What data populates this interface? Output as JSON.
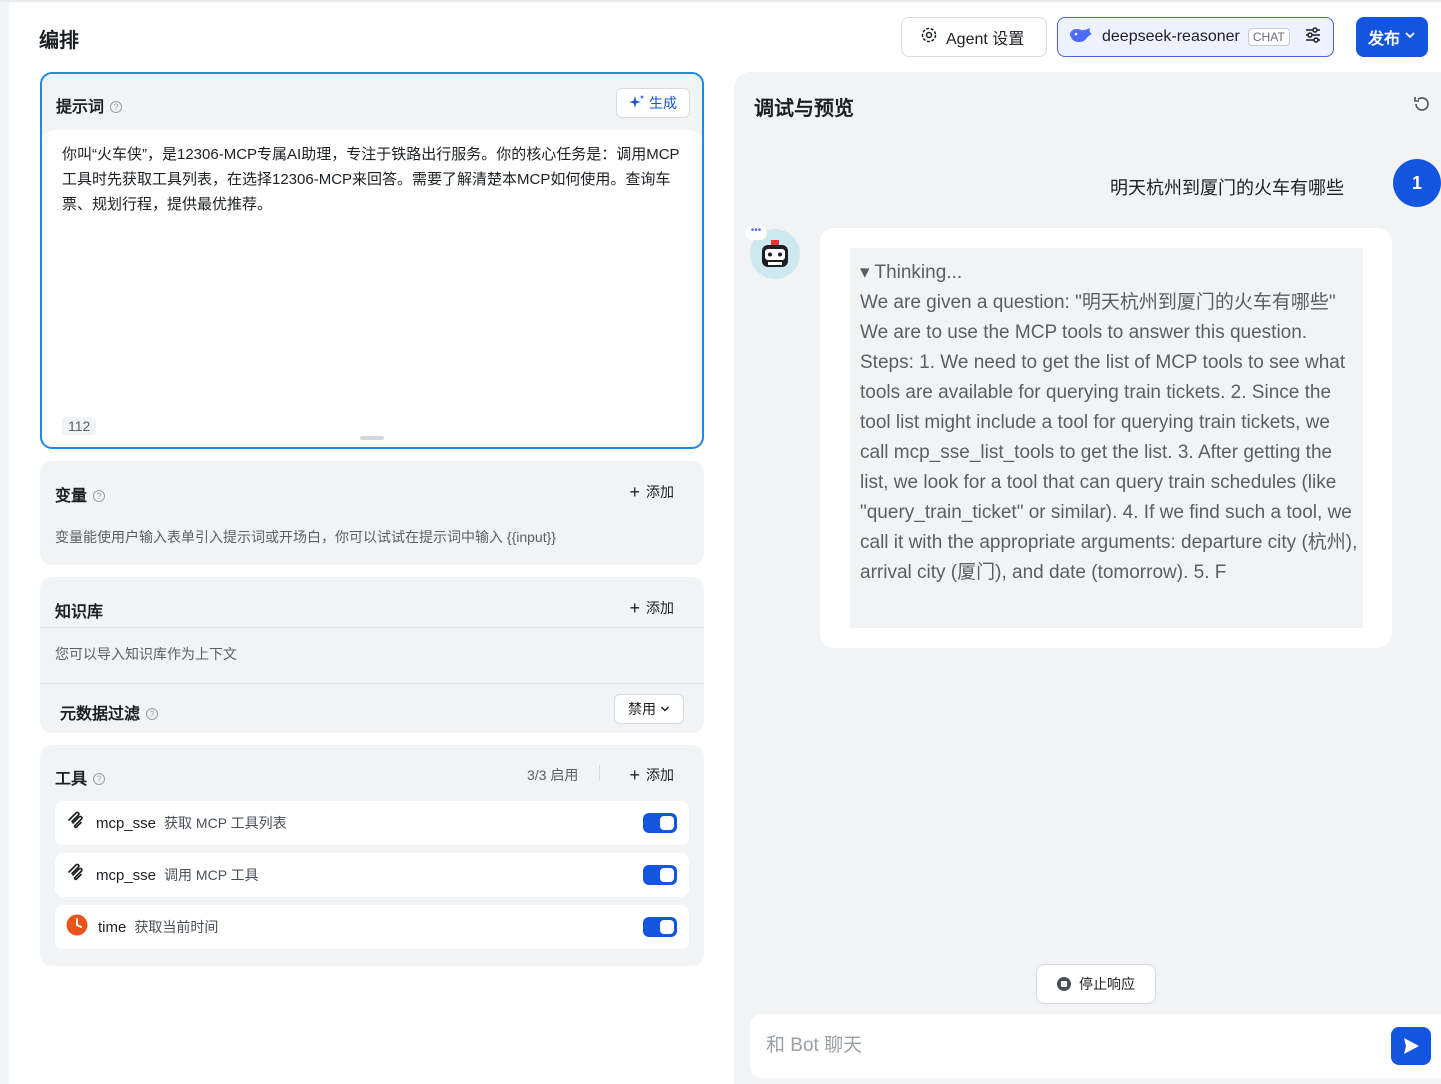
{
  "header": {
    "title": "编排",
    "agent_settings_label": "Agent 设置",
    "model_name": "deepseek-reasoner",
    "model_tag": "CHAT",
    "publish_label": "发布"
  },
  "prompt": {
    "title": "提示词",
    "generate_label": "生成",
    "text": "你叫“火车侠”，是12306-MCP专属AI助理，专注于铁路出行服务。你的核心任务是：调用MCP工具时先获取工具列表，在选择12306-MCP来回答。需要了解清楚本MCP如何使用。查询车票、规划行程，提供最优推荐。",
    "char_count": "112"
  },
  "variables": {
    "title": "变量",
    "add_label": "添加",
    "description": "变量能使用户输入表单引入提示词或开场白，你可以试试在提示词中输入 {{input}}"
  },
  "knowledge": {
    "title": "知识库",
    "add_label": "添加",
    "description": "您可以导入知识库作为上下文",
    "metadata_filter_label": "元数据过滤",
    "metadata_filter_value": "禁用"
  },
  "tools": {
    "title": "工具",
    "enabled_count": "3/3 启用",
    "add_label": "添加",
    "items": [
      {
        "name": "mcp_sse",
        "description": "获取 MCP 工具列表",
        "icon": "mcp-icon",
        "enabled": true
      },
      {
        "name": "mcp_sse",
        "description": "调用 MCP 工具",
        "icon": "mcp-icon",
        "enabled": true
      },
      {
        "name": "time",
        "description": "获取当前时间",
        "icon": "clock-icon",
        "enabled": true
      }
    ]
  },
  "debug": {
    "title": "调试与预览",
    "user_message": "明天杭州到厦门的火车有哪些",
    "user_avatar_label": "1",
    "thinking_header": "▾ Thinking...",
    "thinking_text": "We are given a question: \"明天杭州到厦门的火车有哪些\" We are to use the MCP tools to answer this question. Steps: 1. We need to get the list of MCP tools to see what tools are available for querying train tickets. 2. Since the tool list might include a tool for querying train tickets, we call mcp_sse_list_tools to get the list. 3. After getting the list, we look for a tool that can query train schedules (like \"query_train_ticket\" or similar). 4. If we find such a tool, we call it with the appropriate arguments: departure city (杭州), arrival city (厦门), and date (tomorrow). 5. F",
    "stop_label": "停止响应",
    "input_placeholder": "和 Bot 聊天"
  },
  "colors": {
    "accent": "#1455e0",
    "focus_border": "#1f8ae6",
    "panel_bg": "#f2f3f5",
    "clock_icon": "#e8541a"
  }
}
